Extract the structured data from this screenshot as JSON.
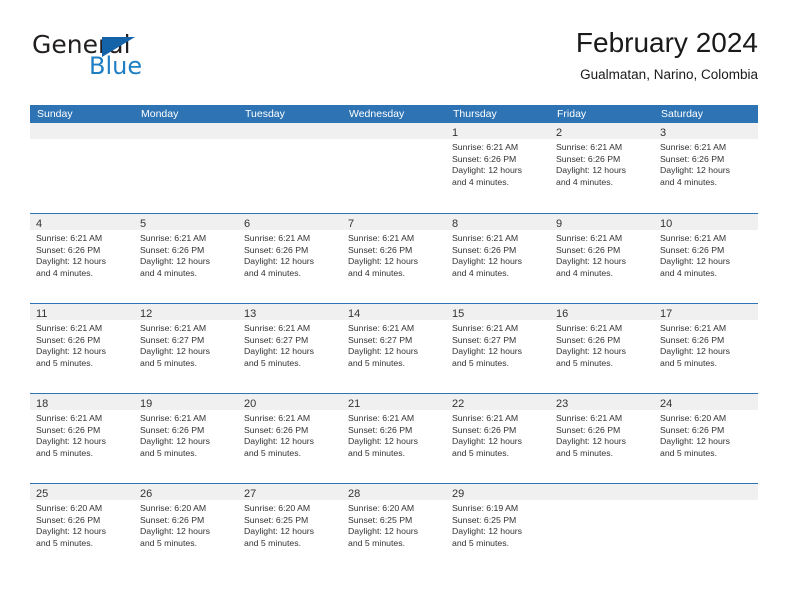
{
  "brand": {
    "name_part1": "General",
    "name_part2": "Blue",
    "triangle_color": "#1463a8",
    "blue_text_color": "#1f7fc4"
  },
  "header": {
    "title": "February 2024",
    "subtitle": "Gualmatan, Narino, Colombia"
  },
  "colors": {
    "header_blue": "#2e74b5",
    "day_band_gray": "#f0f0f0",
    "text": "#333333"
  },
  "weekdays": [
    "Sunday",
    "Monday",
    "Tuesday",
    "Wednesday",
    "Thursday",
    "Friday",
    "Saturday"
  ],
  "weeks": [
    [
      {
        "day": "",
        "sunrise": "",
        "sunset": "",
        "daylight": "",
        "daylight2": ""
      },
      {
        "day": "",
        "sunrise": "",
        "sunset": "",
        "daylight": "",
        "daylight2": ""
      },
      {
        "day": "",
        "sunrise": "",
        "sunset": "",
        "daylight": "",
        "daylight2": ""
      },
      {
        "day": "",
        "sunrise": "",
        "sunset": "",
        "daylight": "",
        "daylight2": ""
      },
      {
        "day": "1",
        "sunrise": "Sunrise: 6:21 AM",
        "sunset": "Sunset: 6:26 PM",
        "daylight": "Daylight: 12 hours",
        "daylight2": "and 4 minutes."
      },
      {
        "day": "2",
        "sunrise": "Sunrise: 6:21 AM",
        "sunset": "Sunset: 6:26 PM",
        "daylight": "Daylight: 12 hours",
        "daylight2": "and 4 minutes."
      },
      {
        "day": "3",
        "sunrise": "Sunrise: 6:21 AM",
        "sunset": "Sunset: 6:26 PM",
        "daylight": "Daylight: 12 hours",
        "daylight2": "and 4 minutes."
      }
    ],
    [
      {
        "day": "4",
        "sunrise": "Sunrise: 6:21 AM",
        "sunset": "Sunset: 6:26 PM",
        "daylight": "Daylight: 12 hours",
        "daylight2": "and 4 minutes."
      },
      {
        "day": "5",
        "sunrise": "Sunrise: 6:21 AM",
        "sunset": "Sunset: 6:26 PM",
        "daylight": "Daylight: 12 hours",
        "daylight2": "and 4 minutes."
      },
      {
        "day": "6",
        "sunrise": "Sunrise: 6:21 AM",
        "sunset": "Sunset: 6:26 PM",
        "daylight": "Daylight: 12 hours",
        "daylight2": "and 4 minutes."
      },
      {
        "day": "7",
        "sunrise": "Sunrise: 6:21 AM",
        "sunset": "Sunset: 6:26 PM",
        "daylight": "Daylight: 12 hours",
        "daylight2": "and 4 minutes."
      },
      {
        "day": "8",
        "sunrise": "Sunrise: 6:21 AM",
        "sunset": "Sunset: 6:26 PM",
        "daylight": "Daylight: 12 hours",
        "daylight2": "and 4 minutes."
      },
      {
        "day": "9",
        "sunrise": "Sunrise: 6:21 AM",
        "sunset": "Sunset: 6:26 PM",
        "daylight": "Daylight: 12 hours",
        "daylight2": "and 4 minutes."
      },
      {
        "day": "10",
        "sunrise": "Sunrise: 6:21 AM",
        "sunset": "Sunset: 6:26 PM",
        "daylight": "Daylight: 12 hours",
        "daylight2": "and 4 minutes."
      }
    ],
    [
      {
        "day": "11",
        "sunrise": "Sunrise: 6:21 AM",
        "sunset": "Sunset: 6:26 PM",
        "daylight": "Daylight: 12 hours",
        "daylight2": "and 5 minutes."
      },
      {
        "day": "12",
        "sunrise": "Sunrise: 6:21 AM",
        "sunset": "Sunset: 6:27 PM",
        "daylight": "Daylight: 12 hours",
        "daylight2": "and 5 minutes."
      },
      {
        "day": "13",
        "sunrise": "Sunrise: 6:21 AM",
        "sunset": "Sunset: 6:27 PM",
        "daylight": "Daylight: 12 hours",
        "daylight2": "and 5 minutes."
      },
      {
        "day": "14",
        "sunrise": "Sunrise: 6:21 AM",
        "sunset": "Sunset: 6:27 PM",
        "daylight": "Daylight: 12 hours",
        "daylight2": "and 5 minutes."
      },
      {
        "day": "15",
        "sunrise": "Sunrise: 6:21 AM",
        "sunset": "Sunset: 6:27 PM",
        "daylight": "Daylight: 12 hours",
        "daylight2": "and 5 minutes."
      },
      {
        "day": "16",
        "sunrise": "Sunrise: 6:21 AM",
        "sunset": "Sunset: 6:26 PM",
        "daylight": "Daylight: 12 hours",
        "daylight2": "and 5 minutes."
      },
      {
        "day": "17",
        "sunrise": "Sunrise: 6:21 AM",
        "sunset": "Sunset: 6:26 PM",
        "daylight": "Daylight: 12 hours",
        "daylight2": "and 5 minutes."
      }
    ],
    [
      {
        "day": "18",
        "sunrise": "Sunrise: 6:21 AM",
        "sunset": "Sunset: 6:26 PM",
        "daylight": "Daylight: 12 hours",
        "daylight2": "and 5 minutes."
      },
      {
        "day": "19",
        "sunrise": "Sunrise: 6:21 AM",
        "sunset": "Sunset: 6:26 PM",
        "daylight": "Daylight: 12 hours",
        "daylight2": "and 5 minutes."
      },
      {
        "day": "20",
        "sunrise": "Sunrise: 6:21 AM",
        "sunset": "Sunset: 6:26 PM",
        "daylight": "Daylight: 12 hours",
        "daylight2": "and 5 minutes."
      },
      {
        "day": "21",
        "sunrise": "Sunrise: 6:21 AM",
        "sunset": "Sunset: 6:26 PM",
        "daylight": "Daylight: 12 hours",
        "daylight2": "and 5 minutes."
      },
      {
        "day": "22",
        "sunrise": "Sunrise: 6:21 AM",
        "sunset": "Sunset: 6:26 PM",
        "daylight": "Daylight: 12 hours",
        "daylight2": "and 5 minutes."
      },
      {
        "day": "23",
        "sunrise": "Sunrise: 6:21 AM",
        "sunset": "Sunset: 6:26 PM",
        "daylight": "Daylight: 12 hours",
        "daylight2": "and 5 minutes."
      },
      {
        "day": "24",
        "sunrise": "Sunrise: 6:20 AM",
        "sunset": "Sunset: 6:26 PM",
        "daylight": "Daylight: 12 hours",
        "daylight2": "and 5 minutes."
      }
    ],
    [
      {
        "day": "25",
        "sunrise": "Sunrise: 6:20 AM",
        "sunset": "Sunset: 6:26 PM",
        "daylight": "Daylight: 12 hours",
        "daylight2": "and 5 minutes."
      },
      {
        "day": "26",
        "sunrise": "Sunrise: 6:20 AM",
        "sunset": "Sunset: 6:26 PM",
        "daylight": "Daylight: 12 hours",
        "daylight2": "and 5 minutes."
      },
      {
        "day": "27",
        "sunrise": "Sunrise: 6:20 AM",
        "sunset": "Sunset: 6:25 PM",
        "daylight": "Daylight: 12 hours",
        "daylight2": "and 5 minutes."
      },
      {
        "day": "28",
        "sunrise": "Sunrise: 6:20 AM",
        "sunset": "Sunset: 6:25 PM",
        "daylight": "Daylight: 12 hours",
        "daylight2": "and 5 minutes."
      },
      {
        "day": "29",
        "sunrise": "Sunrise: 6:19 AM",
        "sunset": "Sunset: 6:25 PM",
        "daylight": "Daylight: 12 hours",
        "daylight2": "and 5 minutes."
      },
      {
        "day": "",
        "sunrise": "",
        "sunset": "",
        "daylight": "",
        "daylight2": ""
      },
      {
        "day": "",
        "sunrise": "",
        "sunset": "",
        "daylight": "",
        "daylight2": ""
      }
    ]
  ]
}
